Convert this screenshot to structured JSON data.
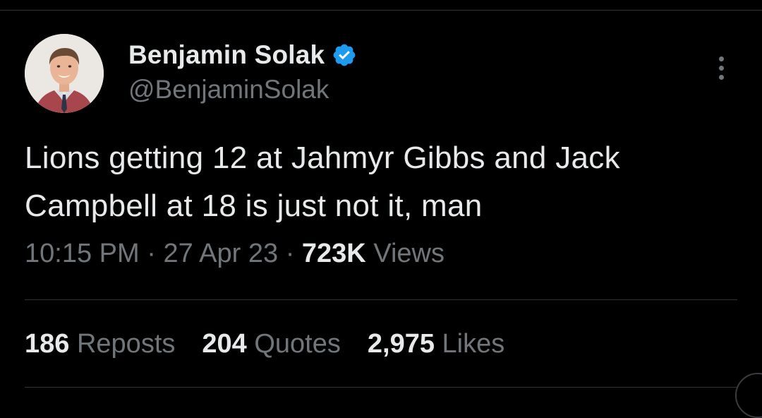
{
  "tweet": {
    "author": {
      "display_name": "Benjamin Solak",
      "handle": "@BenjaminSolak",
      "verified": true,
      "verified_color": "#1d9bf0"
    },
    "text_lines": [
      "Lions getting 12 at Jahmyr Gibbs and Jack",
      "Campbell at 18 is just not it, man"
    ],
    "meta": {
      "time": "10:15 PM",
      "date": "27 Apr 23",
      "views_count": "723K",
      "views_label": "Views",
      "separator": "·"
    },
    "stats": {
      "reposts_count": "186",
      "reposts_label": "Reposts",
      "quotes_count": "204",
      "quotes_label": "Quotes",
      "likes_count": "2,975",
      "likes_label": "Likes"
    }
  },
  "icons": {
    "avatar": "avatar-photo",
    "verified": "verified-badge-icon",
    "more": "more-options-icon"
  },
  "colors": {
    "background": "#000000",
    "primary_text": "#e7e9ea",
    "secondary_text": "#71767b",
    "divider": "#2f3336"
  }
}
